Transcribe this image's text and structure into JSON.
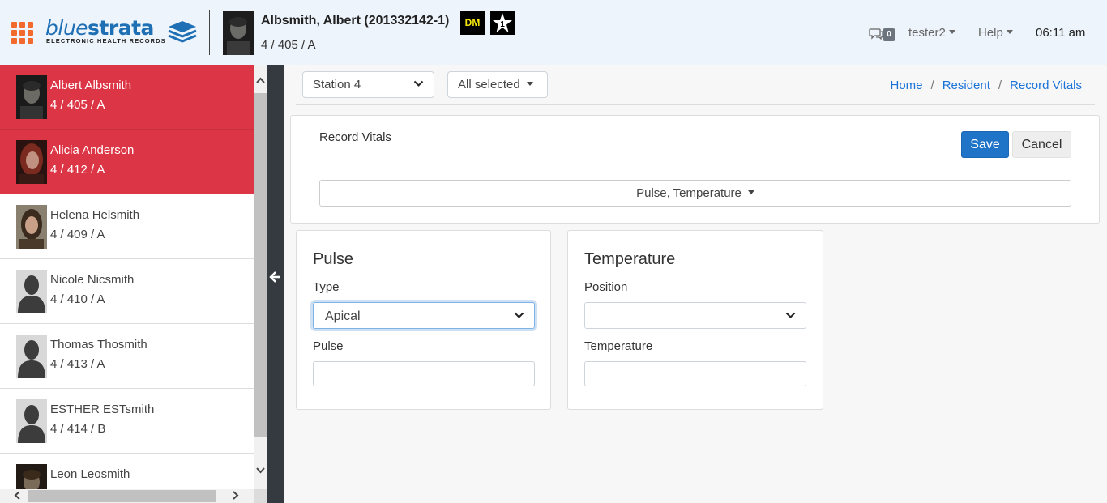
{
  "header": {
    "logo": {
      "part1": "blue",
      "part2": "strata",
      "tagline": "ELECTRONIC HEALTH RECORDS"
    },
    "patient": {
      "name": "Albsmith, Albert (201332142-1)",
      "location": "4 / 405 / A"
    },
    "badges": {
      "dm": "DM",
      "star": "1"
    },
    "messages": {
      "count": "0"
    },
    "user": "tester2",
    "help": "Help",
    "time": "06:11 am"
  },
  "residents": [
    {
      "name": "Albert Albsmith",
      "location": "4 / 405 / A",
      "selected": true,
      "photo": "dark-male"
    },
    {
      "name": "Alicia Anderson",
      "location": "4 / 412 / A",
      "selected": true,
      "photo": "red-hair-female"
    },
    {
      "name": "Helena Helsmith",
      "location": "4 / 409 / A",
      "selected": false,
      "photo": "brunette-female"
    },
    {
      "name": "Nicole Nicsmith",
      "location": "4 / 410 / A",
      "selected": false,
      "photo": "silhouette"
    },
    {
      "name": "Thomas Thosmith",
      "location": "4 / 413 / A",
      "selected": false,
      "photo": "silhouette"
    },
    {
      "name": "ESTHER ESTsmith",
      "location": "4 / 414 / B",
      "selected": false,
      "photo": "silhouette"
    },
    {
      "name": "Leon Leosmith",
      "location": "",
      "selected": false,
      "photo": "dark-male"
    }
  ],
  "filters": {
    "station": "Station 4",
    "selection": "All selected"
  },
  "breadcrumb": [
    "Home",
    "Resident",
    "Record Vitals"
  ],
  "record_vitals": {
    "title": "Record Vitals",
    "save_label": "Save",
    "cancel_label": "Cancel",
    "vitals_selected": "Pulse, Temperature"
  },
  "pulse_card": {
    "title": "Pulse",
    "type_label": "Type",
    "type_value": "Apical",
    "pulse_label": "Pulse",
    "pulse_value": ""
  },
  "temperature_card": {
    "title": "Temperature",
    "position_label": "Position",
    "position_value": "",
    "temperature_label": "Temperature",
    "temperature_value": ""
  },
  "colors": {
    "selected_row": "#dc3545",
    "primary": "#1f74c7",
    "link": "#1a73d9",
    "apps_icon": "#f26a2e"
  }
}
